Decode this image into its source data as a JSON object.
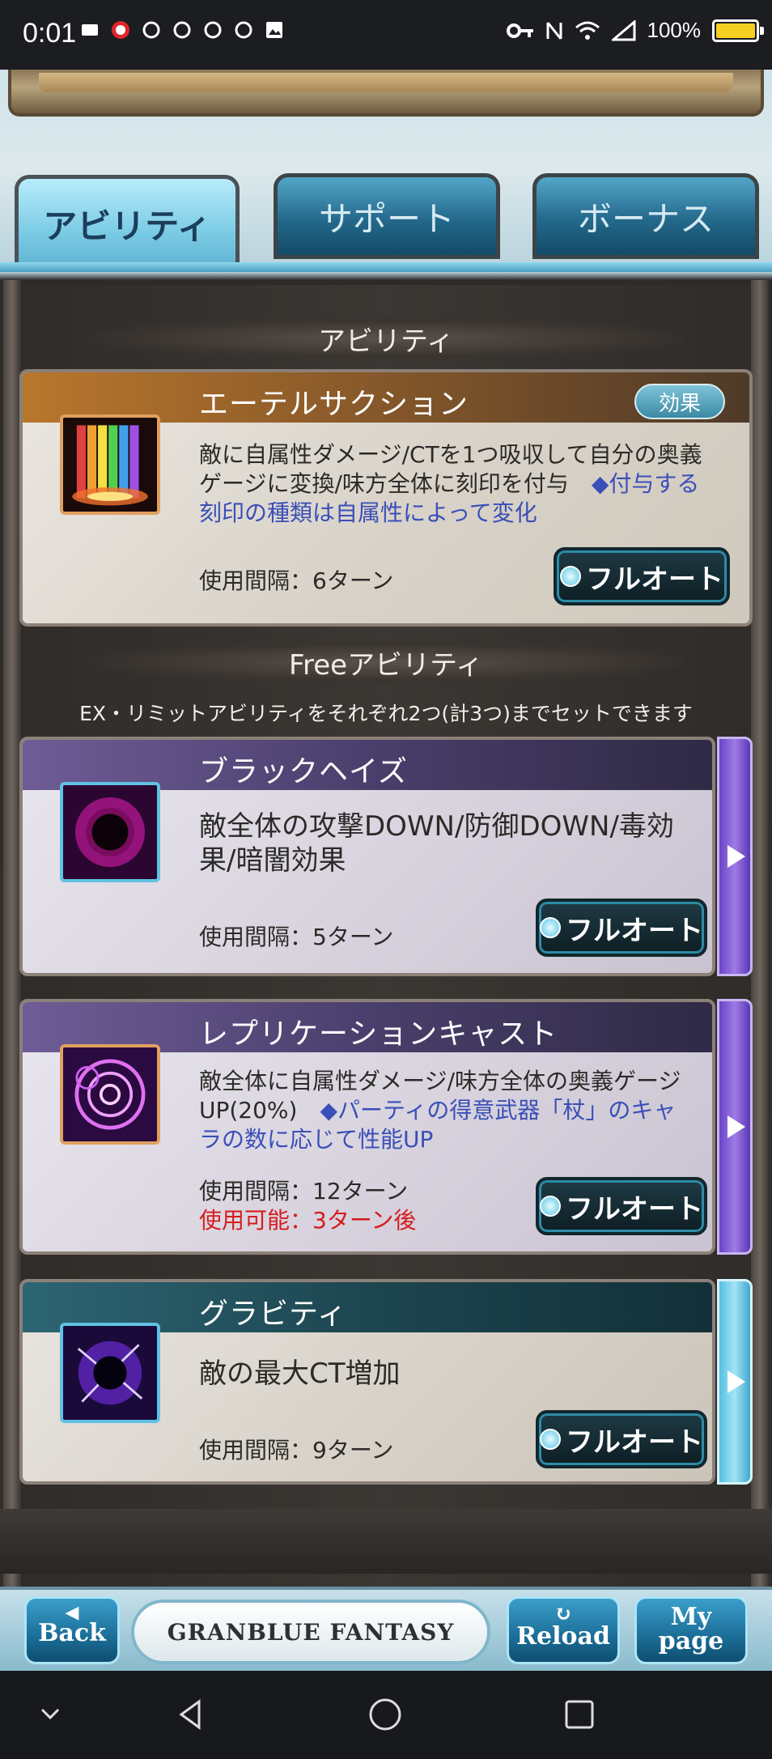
{
  "status_bar": {
    "time": "0:01",
    "battery_text": "100%",
    "battery_color": "#f4d020"
  },
  "tabs": [
    {
      "label": "アビリティ",
      "active": true
    },
    {
      "label": "サポート",
      "active": false
    },
    {
      "label": "ボーナス",
      "active": false
    }
  ],
  "ability_section": {
    "header": "アビリティ",
    "card": {
      "title": "エーテルサクション",
      "effect_button": "効果",
      "icon": "rainbow-pillar-icon",
      "desc_black": "敵に自属性ダメージ/CTを1つ吸収して自分の奥義ゲージに変換/味方全体に刻印を付与　",
      "desc_blue": "◆付与する刻印の種類は自属性によって変化",
      "interval": "使用間隔：6ターン",
      "fullauto": "フルオート"
    }
  },
  "free_section": {
    "header": "Freeアビリティ",
    "note": "EX・リミットアビリティをそれぞれ2つ(計3つ)までセットできます",
    "cards": [
      {
        "title": "ブラックヘイズ",
        "icon": "black-haze-icon",
        "desc": "敵全体の攻撃DOWN/防御DOWN/毒効果/暗闇効果",
        "interval": "使用間隔：5ターン",
        "fullauto": "フルオート"
      },
      {
        "title": "レプリケーションキャスト",
        "icon": "magic-circle-icon",
        "desc_black": "敵全体に自属性ダメージ/味方全体の奥義ゲージUP(20%)　",
        "desc_blue": "◆パーティの得意武器「杖」のキャラの数に応じて性能UP",
        "interval": "使用間隔：12ターン",
        "cooldown": "使用可能：3ターン後",
        "fullauto": "フルオート"
      },
      {
        "title": "グラビティ",
        "icon": "gravity-icon",
        "desc": "敵の最大CT増加",
        "interval": "使用間隔：9ターン",
        "fullauto": "フルオート"
      }
    ]
  },
  "bottom_nav": {
    "back": [
      "Back"
    ],
    "logo": "GRANBLUE FANTASY",
    "reload": "Reload",
    "mypage": [
      "My",
      "page"
    ]
  },
  "colors": {
    "accent_blue": "#3a4fb8",
    "cooldown_red": "#d61c1c",
    "tab_active": "#7bcbe5"
  }
}
